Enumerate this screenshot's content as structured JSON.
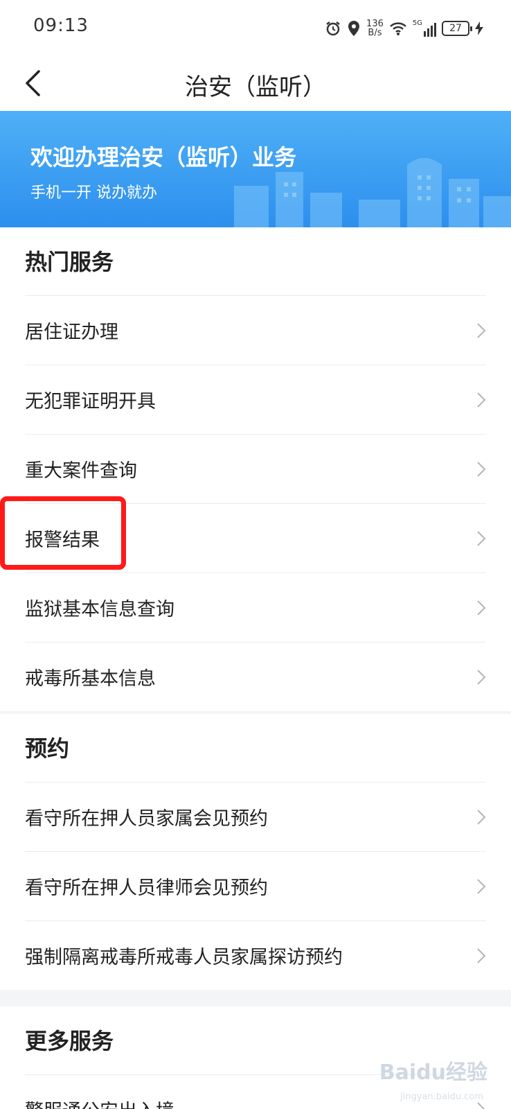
{
  "status_bar": {
    "time": "09:13",
    "net_speed_value": "136",
    "net_speed_unit": "B/s",
    "network": "5G",
    "battery": "27"
  },
  "nav": {
    "title": "治安（监听）"
  },
  "banner": {
    "title": "欢迎办理治安（监听）业务",
    "subtitle": "手机一开 说办就办"
  },
  "sections": {
    "hot": {
      "title": "热门服务",
      "items": [
        "居住证办理",
        "无犯罪证明开具",
        "重大案件查询",
        "报警结果",
        "监狱基本信息查询",
        "戒毒所基本信息"
      ]
    },
    "appointment": {
      "title": "预约",
      "items": [
        "看守所在押人员家属会见预约",
        "看守所在押人员律师会见预约",
        "强制隔离戒毒所戒毒人员家属探访预约"
      ]
    },
    "more": {
      "title": "更多服务",
      "items": [
        "警服通公安出入境"
      ]
    }
  },
  "watermark": {
    "brand": "Baidu经验",
    "url": "jingyan.baidu.com"
  },
  "colors": {
    "banner": "#2d8fee",
    "highlight": "#ff1a1a"
  }
}
